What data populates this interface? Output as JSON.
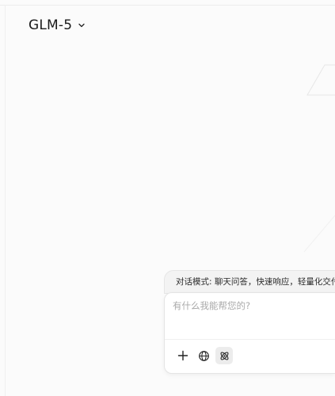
{
  "header": {
    "model_name": "GLM-5",
    "model_dropdown_icon": "chevron-down-icon"
  },
  "composer": {
    "mode_hint": "对话模式: 聊天问答，快速响应，轻量化交付",
    "placeholder": "有什么我能帮您的?",
    "value": "",
    "tools": [
      {
        "name": "add-attachment",
        "icon": "plus-icon"
      },
      {
        "name": "web-search",
        "icon": "globe-icon"
      },
      {
        "name": "deep-think",
        "icon": "atom-icon",
        "active": true
      }
    ]
  },
  "colors": {
    "background": "#fbfbfb",
    "card": "#ffffff",
    "hint_bar": "#f3f3f3",
    "text": "#1f1f1f",
    "placeholder": "#a9a9a9"
  }
}
